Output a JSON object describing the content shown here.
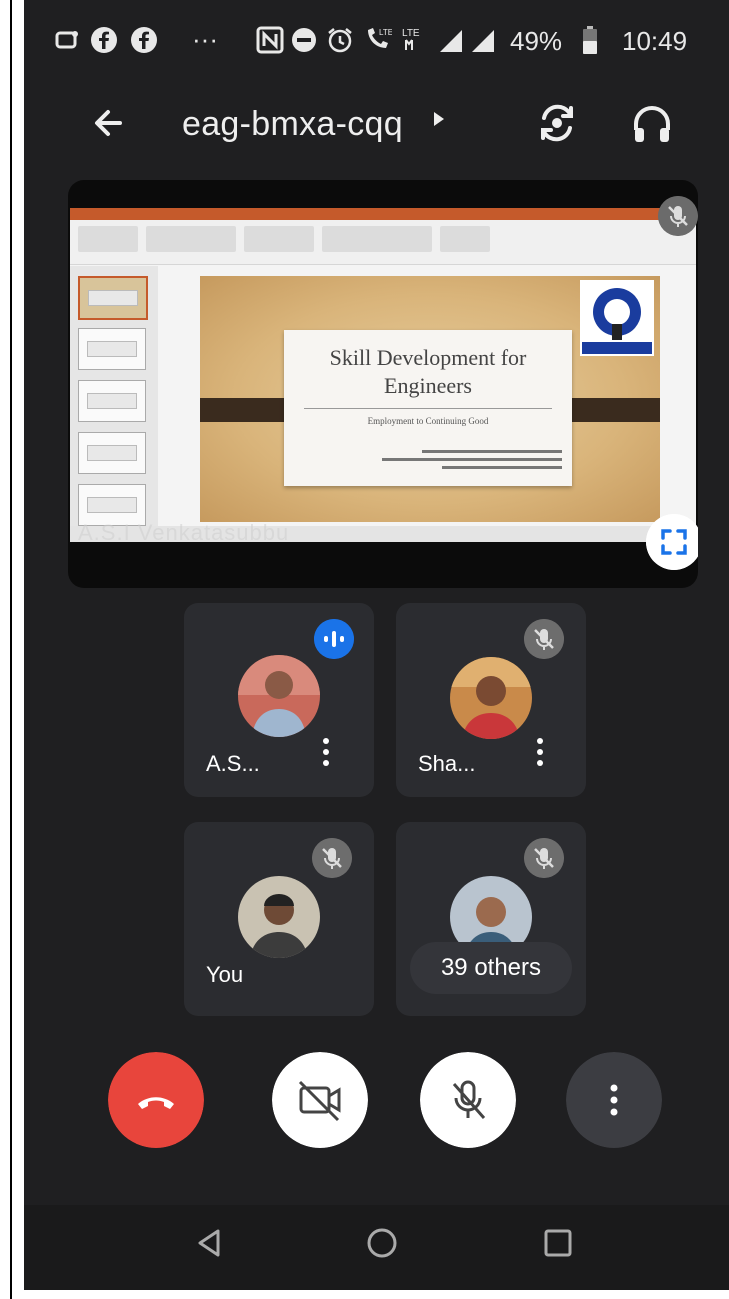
{
  "status_bar": {
    "battery": "49%",
    "time": "10:49",
    "ellipsis": "···",
    "lte_1": "LTE",
    "lte_2": "LTE"
  },
  "top_bar": {
    "meeting_code": "eag-bmxa-cqq",
    "icons": [
      "back-arrow-icon",
      "switch-camera-icon",
      "headphones-icon"
    ]
  },
  "presentation": {
    "slide_title": "Skill Development for Engineers",
    "slide_subtitle": "Employment to Continuing Good",
    "presenter_label": "A.S.I Venkatasubbu"
  },
  "participants": [
    {
      "name": "A.S...",
      "state": "speaking"
    },
    {
      "name": "Sha...",
      "state": "muted"
    },
    {
      "name": "You",
      "state": "muted"
    },
    {
      "name": "39 others",
      "state": "muted"
    }
  ],
  "controls": {
    "items": [
      "end-call",
      "camera-off",
      "mic-off",
      "more-options"
    ],
    "end_call_color": "#e8453c",
    "speaking_color": "#1a73e8"
  },
  "navigation": [
    "back",
    "home",
    "recents"
  ]
}
